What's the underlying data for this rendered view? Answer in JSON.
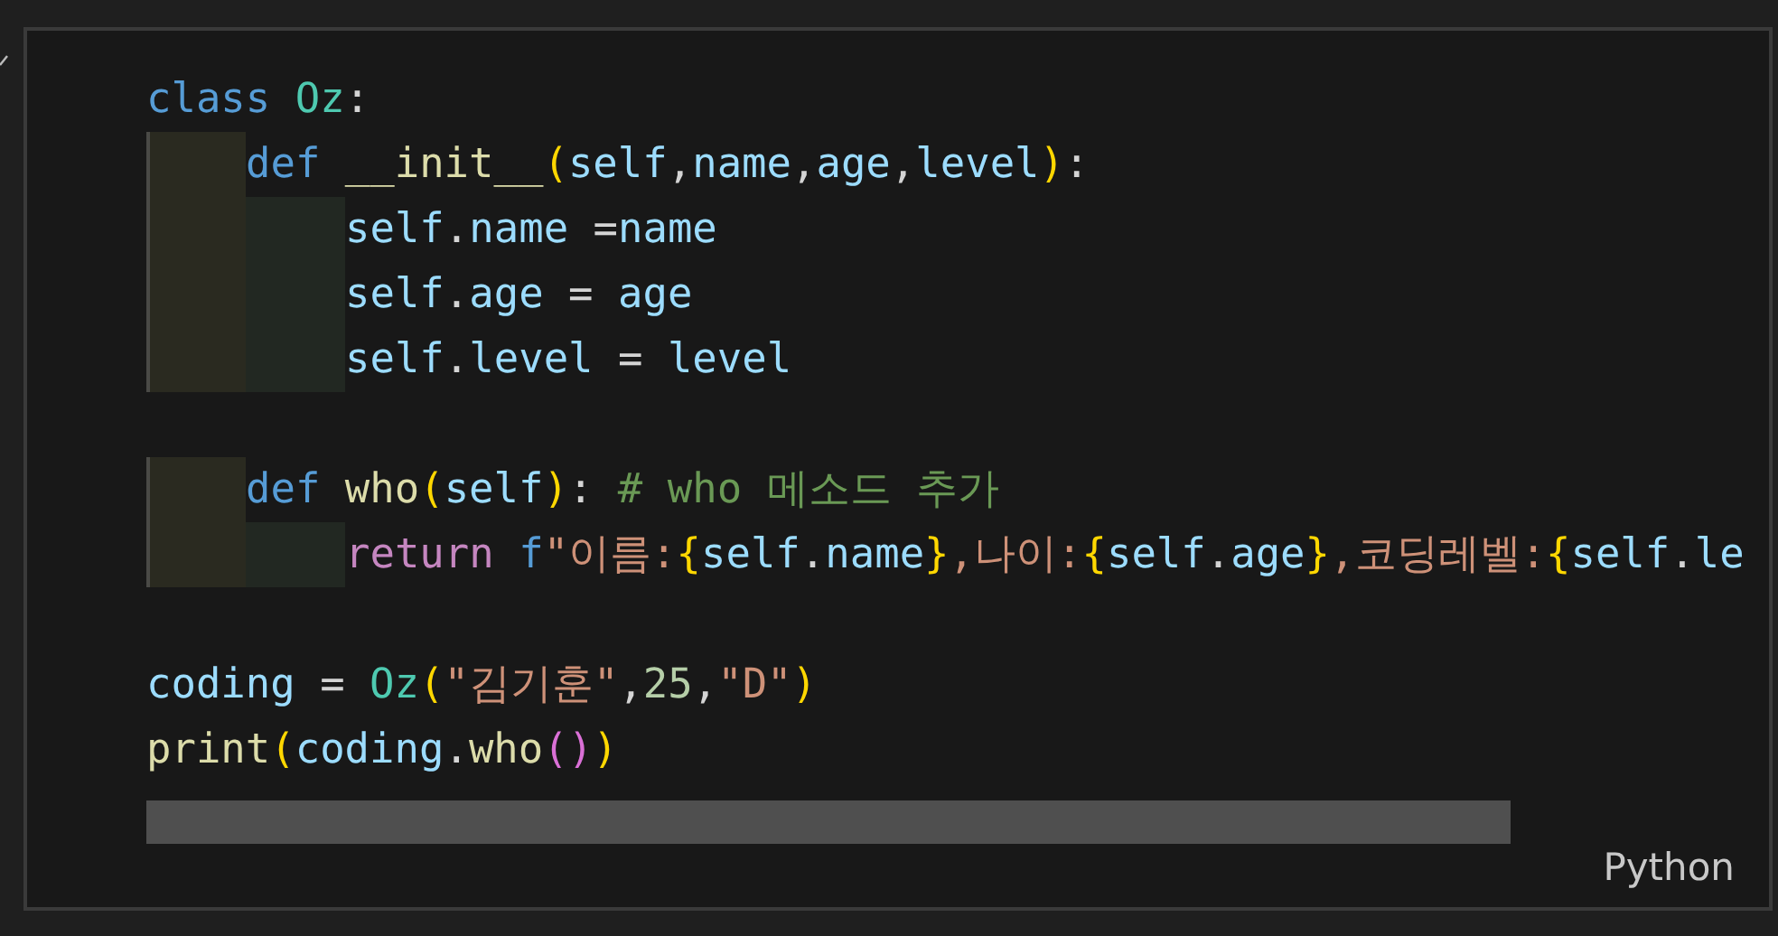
{
  "cell": {
    "lines": [
      {
        "kind": "code",
        "tokens": [
          {
            "text": "class ",
            "kind": "keyword"
          },
          {
            "text": "Oz",
            "kind": "class"
          },
          {
            "text": ":",
            "kind": "punct"
          }
        ],
        "children": [
          {
            "kind": "code",
            "tokens": [
              {
                "text": "def ",
                "kind": "keyword"
              },
              {
                "text": "__init__",
                "kind": "function"
              },
              {
                "text": "(",
                "kind": "bracket"
              },
              {
                "text": "self",
                "kind": "variable"
              },
              {
                "text": ",",
                "kind": "punct"
              },
              {
                "text": "name",
                "kind": "variable"
              },
              {
                "text": ",",
                "kind": "punct"
              },
              {
                "text": "age",
                "kind": "variable"
              },
              {
                "text": ",",
                "kind": "punct"
              },
              {
                "text": "level",
                "kind": "variable"
              },
              {
                "text": ")",
                "kind": "bracket"
              },
              {
                "text": ":",
                "kind": "punct"
              }
            ],
            "children": [
              {
                "kind": "code",
                "tokens": [
                  {
                    "text": "self",
                    "kind": "variable"
                  },
                  {
                    "text": ".",
                    "kind": "punct"
                  },
                  {
                    "text": "name",
                    "kind": "variable"
                  },
                  {
                    "text": " =",
                    "kind": "punct"
                  },
                  {
                    "text": "name",
                    "kind": "variable"
                  }
                ]
              },
              {
                "kind": "code",
                "tokens": [
                  {
                    "text": "self",
                    "kind": "variable"
                  },
                  {
                    "text": ".",
                    "kind": "punct"
                  },
                  {
                    "text": "age",
                    "kind": "variable"
                  },
                  {
                    "text": " = ",
                    "kind": "punct"
                  },
                  {
                    "text": "age",
                    "kind": "variable"
                  }
                ]
              },
              {
                "kind": "code",
                "tokens": [
                  {
                    "text": "self",
                    "kind": "variable"
                  },
                  {
                    "text": ".",
                    "kind": "punct"
                  },
                  {
                    "text": "level",
                    "kind": "variable"
                  },
                  {
                    "text": " = ",
                    "kind": "punct"
                  },
                  {
                    "text": "level",
                    "kind": "variable"
                  }
                ]
              }
            ]
          },
          {
            "kind": "blank"
          },
          {
            "kind": "code",
            "tokens": [
              {
                "text": "def ",
                "kind": "keyword"
              },
              {
                "text": "who",
                "kind": "function"
              },
              {
                "text": "(",
                "kind": "bracket"
              },
              {
                "text": "self",
                "kind": "variable"
              },
              {
                "text": ")",
                "kind": "bracket"
              },
              {
                "text": ": ",
                "kind": "punct"
              },
              {
                "text": "# who 메소드 추가",
                "kind": "comment"
              }
            ],
            "children": [
              {
                "kind": "code",
                "tokens": [
                  {
                    "text": "return ",
                    "kind": "control"
                  },
                  {
                    "text": "f",
                    "kind": "keyword"
                  },
                  {
                    "text": "\"이름:",
                    "kind": "string"
                  },
                  {
                    "text": "{",
                    "kind": "bracket"
                  },
                  {
                    "text": "self",
                    "kind": "variable"
                  },
                  {
                    "text": ".",
                    "kind": "punct"
                  },
                  {
                    "text": "name",
                    "kind": "variable"
                  },
                  {
                    "text": "}",
                    "kind": "bracket"
                  },
                  {
                    "text": ",나이:",
                    "kind": "string"
                  },
                  {
                    "text": "{",
                    "kind": "bracket"
                  },
                  {
                    "text": "self",
                    "kind": "variable"
                  },
                  {
                    "text": ".",
                    "kind": "punct"
                  },
                  {
                    "text": "age",
                    "kind": "variable"
                  },
                  {
                    "text": "}",
                    "kind": "bracket"
                  },
                  {
                    "text": ",코딩레벨:",
                    "kind": "string"
                  },
                  {
                    "text": "{",
                    "kind": "bracket"
                  },
                  {
                    "text": "self",
                    "kind": "variable"
                  },
                  {
                    "text": ".",
                    "kind": "punct"
                  },
                  {
                    "text": "le",
                    "kind": "variable"
                  }
                ]
              }
            ]
          }
        ]
      },
      {
        "kind": "blank"
      },
      {
        "kind": "code",
        "tokens": [
          {
            "text": "coding",
            "kind": "variable"
          },
          {
            "text": " = ",
            "kind": "punct"
          },
          {
            "text": "Oz",
            "kind": "class"
          },
          {
            "text": "(",
            "kind": "bracket"
          },
          {
            "text": "\"김기훈\"",
            "kind": "string"
          },
          {
            "text": ",",
            "kind": "punct"
          },
          {
            "text": "25",
            "kind": "number"
          },
          {
            "text": ",",
            "kind": "punct"
          },
          {
            "text": "\"D\"",
            "kind": "string"
          },
          {
            "text": ")",
            "kind": "bracket"
          }
        ]
      },
      {
        "kind": "code",
        "tokens": [
          {
            "text": "print",
            "kind": "function"
          },
          {
            "text": "(",
            "kind": "bracket"
          },
          {
            "text": "coding",
            "kind": "variable"
          },
          {
            "text": ".",
            "kind": "punct"
          },
          {
            "text": "who",
            "kind": "function"
          },
          {
            "text": "()",
            "kind": "bracket2"
          },
          {
            "text": ")",
            "kind": "bracket"
          }
        ]
      }
    ],
    "language": "Python"
  }
}
